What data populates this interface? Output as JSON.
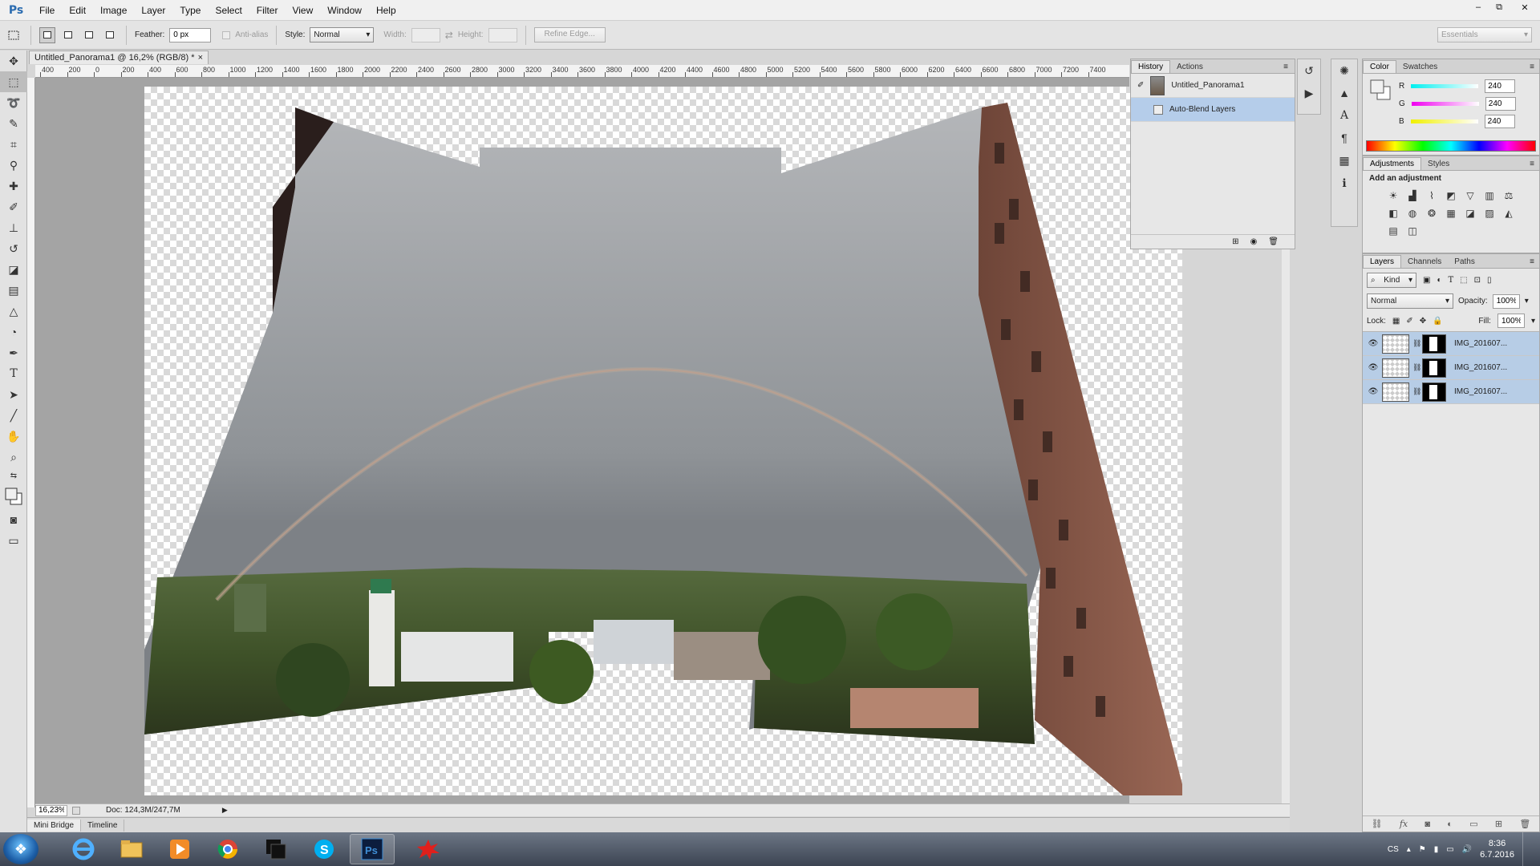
{
  "app": {
    "logo": "Ps",
    "menu": [
      "File",
      "Edit",
      "Image",
      "Layer",
      "Type",
      "Select",
      "Filter",
      "View",
      "Window",
      "Help"
    ],
    "window_controls": [
      "–",
      "⧉",
      "✕"
    ]
  },
  "options": {
    "feather_label": "Feather:",
    "feather_value": "0 px",
    "antialias_label": "Anti-alias",
    "style_label": "Style:",
    "style_value": "Normal",
    "width_label": "Width:",
    "height_label": "Height:",
    "refine_edge": "Refine Edge...",
    "workspace": "Essentials"
  },
  "document": {
    "tab_title": "Untitled_Panorama1 @ 16,2% (RGB/8) *",
    "tab_close": "×",
    "ruler_labels": [
      "400",
      "200",
      "0",
      "200",
      "400",
      "600",
      "800",
      "1000",
      "1200",
      "1400",
      "1600",
      "1800",
      "2000",
      "2200",
      "2400",
      "2600",
      "2800",
      "3000",
      "3200",
      "3400",
      "3600",
      "3800",
      "4000",
      "4200",
      "4400",
      "4600",
      "4800",
      "5000",
      "5200",
      "5400",
      "5600",
      "5800",
      "6000",
      "6200",
      "6400",
      "6600",
      "6800",
      "7000",
      "7200",
      "7400"
    ],
    "zoom": "16,23%",
    "doc_info": "Doc: 124,3M/247,7M"
  },
  "bottom_tabs": [
    "Mini Bridge",
    "Timeline"
  ],
  "history": {
    "tabs": [
      "History",
      "Actions"
    ],
    "snapshot": "Untitled_Panorama1",
    "items": [
      {
        "label": "Auto-Blend Layers",
        "selected": true
      }
    ]
  },
  "color": {
    "tabs": [
      "Color",
      "Swatches"
    ],
    "channels": [
      {
        "label": "R",
        "value": "240",
        "track": "#00d8d8"
      },
      {
        "label": "G",
        "value": "240",
        "track": "#d800d8"
      },
      {
        "label": "B",
        "value": "240",
        "track": "#d8d800"
      }
    ]
  },
  "adjustments": {
    "tabs": [
      "Adjustments",
      "Styles"
    ],
    "heading": "Add an adjustment",
    "icons": [
      "brightness-icon",
      "levels-icon",
      "curves-icon",
      "exposure-icon",
      "vibrance-icon",
      "hue-saturation-icon",
      "color-balance-icon",
      "black-white-icon",
      "photo-filter-icon",
      "channel-mixer-icon",
      "color-lookup-icon",
      "invert-icon",
      "posterize-icon",
      "threshold-icon",
      "gradient-map-icon",
      "selective-color-icon"
    ]
  },
  "layers": {
    "tabs": [
      "Layers",
      "Channels",
      "Paths"
    ],
    "kind_label": "Kind",
    "blend_mode": "Normal",
    "opacity_label": "Opacity:",
    "opacity": "100%",
    "lock_label": "Lock:",
    "fill_label": "Fill:",
    "fill": "100%",
    "items": [
      {
        "name": "IMG_201607..."
      },
      {
        "name": "IMG_201607..."
      },
      {
        "name": "IMG_201607..."
      }
    ]
  },
  "taskbar": {
    "keyboard_layout": "CS",
    "time": "8:36",
    "date": "6.7.2016"
  }
}
